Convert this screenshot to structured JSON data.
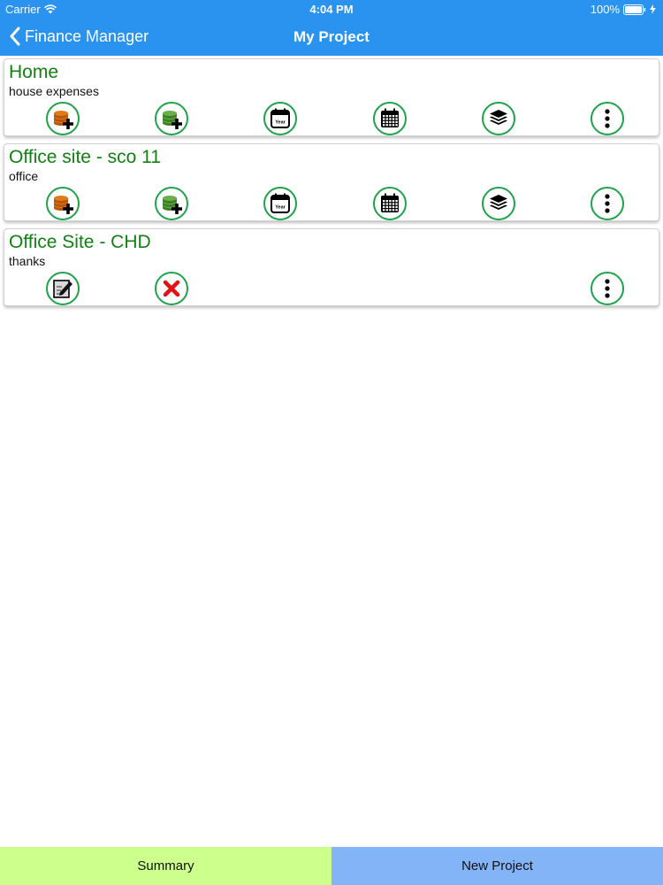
{
  "status_bar": {
    "carrier": "Carrier",
    "time": "4:04 PM",
    "battery": "100%"
  },
  "nav": {
    "back_label": "Finance Manager",
    "title": "My Project"
  },
  "projects": [
    {
      "name": "Home",
      "description": "house expenses",
      "actions": [
        "add-income-icon",
        "add-expense-icon",
        "year-calendar-icon",
        "month-calendar-icon",
        "layers-icon",
        "more-icon"
      ]
    },
    {
      "name": "Office site - sco 11",
      "description": "office",
      "actions": [
        "add-income-icon",
        "add-expense-icon",
        "year-calendar-icon",
        "month-calendar-icon",
        "layers-icon",
        "more-icon"
      ]
    },
    {
      "name": "Office Site - CHD",
      "description": "thanks",
      "actions": [
        "edit-icon",
        "delete-icon",
        "more-icon"
      ]
    }
  ],
  "year_icon_text": "Year",
  "bottom": {
    "summary_label": "Summary",
    "new_project_label": "New Project"
  },
  "colors": {
    "nav": "#2a93f0",
    "title_green": "#128012",
    "ring_green": "#1ea34b",
    "summary_bg": "#ccff8c",
    "new_project_bg": "#82b4f7"
  }
}
